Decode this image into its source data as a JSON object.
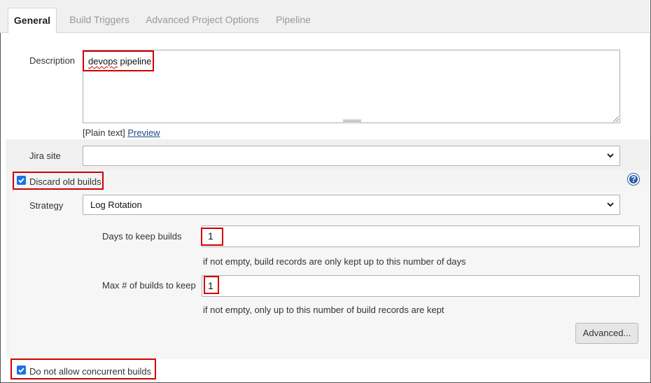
{
  "tabs": [
    {
      "label": "General",
      "active": true
    },
    {
      "label": "Build Triggers",
      "active": false
    },
    {
      "label": "Advanced Project Options",
      "active": false
    },
    {
      "label": "Pipeline",
      "active": false
    }
  ],
  "description": {
    "label": "Description",
    "value_word1": "devops",
    "value_word2": "pipeline",
    "format_text": "[Plain text]",
    "preview_link": "Preview"
  },
  "jira": {
    "label": "Jira site",
    "selected": ""
  },
  "discard_old_builds": {
    "label": "Discard old builds",
    "checked": true,
    "help_glyph": "?"
  },
  "strategy": {
    "label": "Strategy",
    "selected": "Log Rotation"
  },
  "days_to_keep": {
    "label": "Days to keep builds",
    "value": "1",
    "hint": "if not empty, build records are only kept up to this number of days"
  },
  "max_builds": {
    "label": "Max # of builds to keep",
    "value": "1",
    "hint": "if not empty, only up to this number of build records are kept"
  },
  "advanced_button": {
    "label": "Advanced..."
  },
  "concurrent": {
    "label": "Do not allow concurrent builds",
    "checked": true
  },
  "colors": {
    "accent": "#1a73e8",
    "highlight": "#d00000",
    "link": "#204a87"
  },
  "icons": [
    "checkbox-checked-icon",
    "chevron-down-icon",
    "help-icon"
  ]
}
